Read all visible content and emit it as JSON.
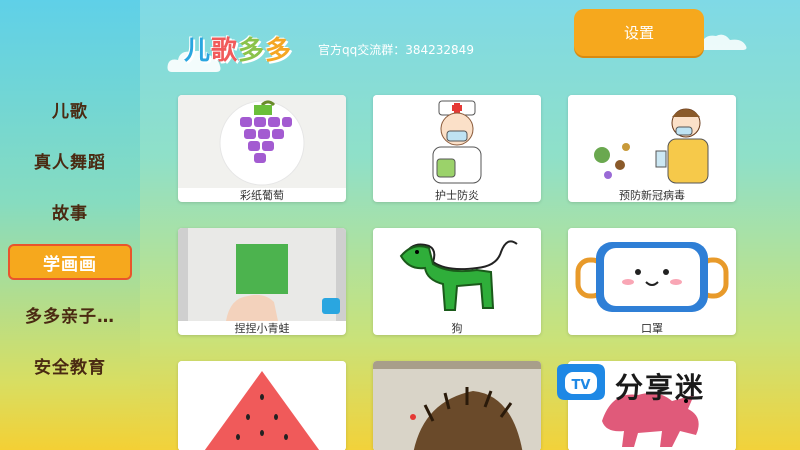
{
  "app": {
    "logo_text": [
      "儿",
      "歌",
      "多",
      "多"
    ],
    "logo_colors": [
      "#2aa6e0",
      "#f15a5a",
      "#8bc34a",
      "#f5a623"
    ],
    "qq_group": "官方qq交流群：384232849",
    "settings_label": "设置"
  },
  "colors": {
    "accent": "#f6a81d",
    "active_border": "#e9542c",
    "nav_text": "#4a2a12"
  },
  "sidebar": {
    "items": [
      {
        "label": "儿歌",
        "active": false
      },
      {
        "label": "真人舞蹈",
        "active": false
      },
      {
        "label": "故事",
        "active": false
      },
      {
        "label": "学画画",
        "active": true
      },
      {
        "label": "多多亲子…",
        "active": false
      },
      {
        "label": "安全教育",
        "active": false
      }
    ]
  },
  "cards": [
    {
      "caption": "彩纸葡萄"
    },
    {
      "caption": "护士防炎"
    },
    {
      "caption": "预防新冠病毒"
    },
    {
      "caption": "捏捏小青蛙"
    },
    {
      "caption": "狗"
    },
    {
      "caption": "口罩"
    },
    {
      "caption": ""
    },
    {
      "caption": ""
    },
    {
      "caption": ""
    }
  ],
  "watermark": {
    "badge": "TV",
    "text": "分享迷"
  }
}
